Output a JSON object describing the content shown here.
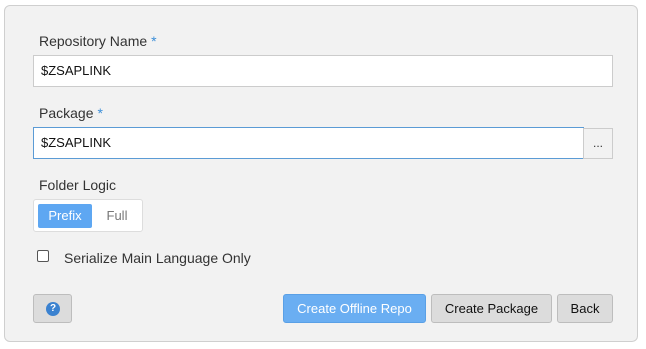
{
  "form": {
    "repo_name": {
      "label": "Repository Name",
      "required_mark": "*",
      "value": "$ZSAPLINK"
    },
    "package": {
      "label": "Package",
      "required_mark": "*",
      "value": "$ZSAPLINK",
      "browse_label": "..."
    },
    "folder_logic": {
      "label": "Folder Logic",
      "options": [
        "Prefix",
        "Full"
      ],
      "selected": "Prefix"
    },
    "serialize_main_language": {
      "label": "Serialize Main Language Only",
      "checked": false
    }
  },
  "buttons": {
    "help_icon": "?",
    "create_offline_repo": "Create Offline Repo",
    "create_package": "Create Package",
    "back": "Back"
  },
  "colors": {
    "accent": "#5ea7f2",
    "required": "#3b8ed8",
    "panel_bg": "#f2f2f2"
  }
}
